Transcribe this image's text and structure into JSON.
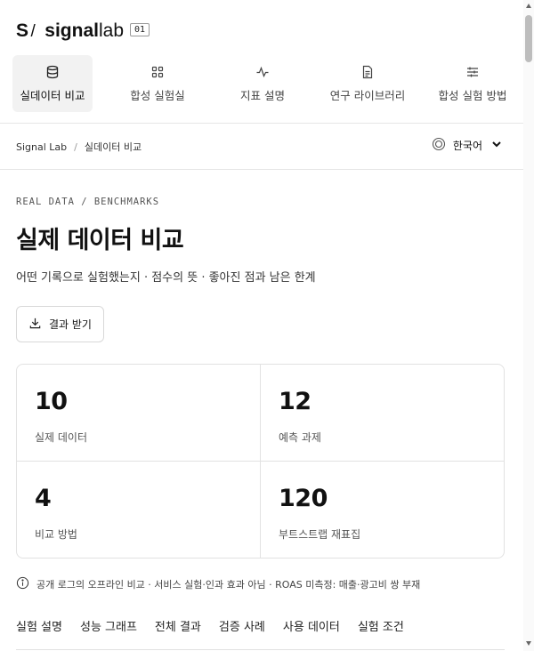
{
  "brand": {
    "mark": "S",
    "mark_slash": "/",
    "name_bold": "signal",
    "name_light": "lab",
    "badge": "01"
  },
  "nav": [
    {
      "label": "실데이터 비교",
      "icon": "database-icon",
      "active": true
    },
    {
      "label": "합성 실험실",
      "icon": "grid-icon",
      "active": false
    },
    {
      "label": "지표 설명",
      "icon": "pulse-icon",
      "active": false
    },
    {
      "label": "연구 라이브러리",
      "icon": "document-icon",
      "active": false
    },
    {
      "label": "합성 실험 방법",
      "icon": "sliders-icon",
      "active": false
    }
  ],
  "breadcrumb": {
    "root": "Signal Lab",
    "separator": "/",
    "current": "실데이터 비교"
  },
  "language": {
    "label": "한국어",
    "icon": "globe-icon"
  },
  "page": {
    "eyebrow": "REAL DATA / BENCHMARKS",
    "title": "실제 데이터 비교",
    "subtitle": "어떤 기록으로 실험했는지 · 점수의 뜻 · 좋아진 점과 남은 한계"
  },
  "download_button": {
    "label": "결과 받기",
    "icon": "download-icon"
  },
  "stats": [
    {
      "value": "10",
      "label": "실제 데이터"
    },
    {
      "value": "12",
      "label": "예측 과제"
    },
    {
      "value": "4",
      "label": "비교 방법"
    },
    {
      "value": "120",
      "label": "부트스트랩 재표집"
    }
  ],
  "note": {
    "icon": "info-icon",
    "text": "공개 로그의 오프라인 비교 · 서비스 실험·인과 효과 아님 · ROAS 미측정: 매출·광고비 쌍 부재"
  },
  "tabs": [
    {
      "label": "실험 설명"
    },
    {
      "label": "성능 그래프"
    },
    {
      "label": "전체 결과"
    },
    {
      "label": "검증 사례"
    },
    {
      "label": "사용 데이터"
    },
    {
      "label": "실험 조건"
    }
  ],
  "colors": {
    "text": "#111111",
    "muted": "#555555",
    "border": "#e2e2e2",
    "active_bg": "#f2f2f2"
  }
}
